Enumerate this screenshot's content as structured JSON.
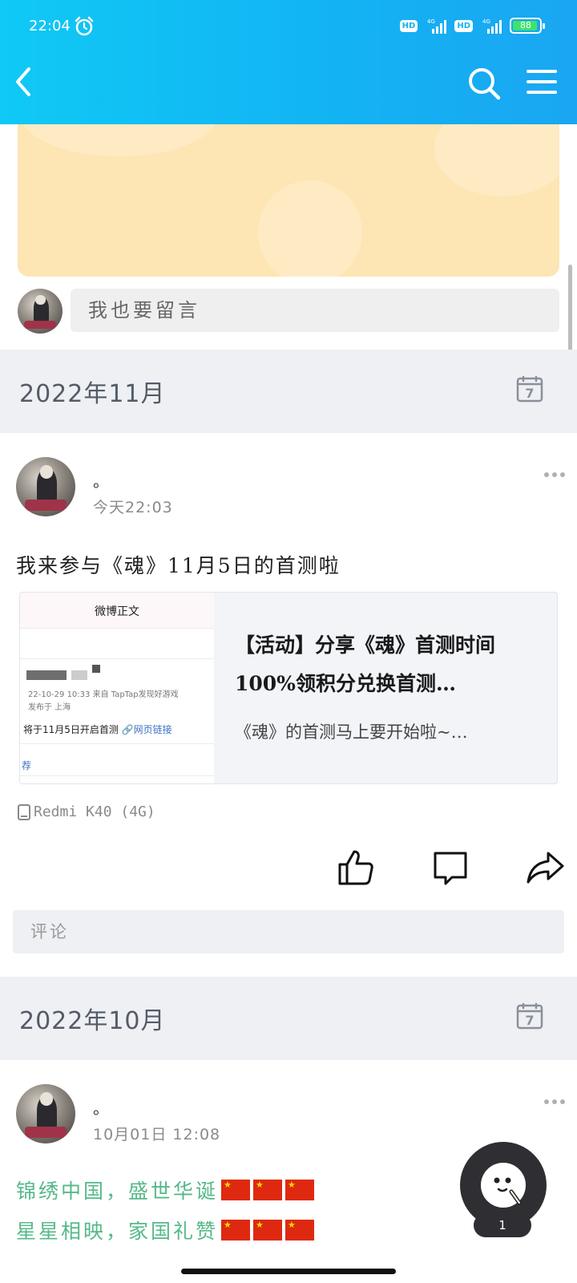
{
  "status_bar": {
    "time": "22:04",
    "hd_label": "HD",
    "net_label": "4G",
    "battery": "88"
  },
  "comment_box": {
    "placeholder": "我也要留言"
  },
  "months": [
    {
      "label": "2022年11月"
    },
    {
      "label": "2022年10月"
    }
  ],
  "posts": [
    {
      "author": "。",
      "time": "今天22:03",
      "text": "我来参与《魂》11月5日的首测啦",
      "link_card": {
        "thumb_title": "微博正文",
        "thumb_meta_1": "22-10-29 10:33  来自 TapTap发现好游戏",
        "thumb_meta_2": "发布于 上海",
        "thumb_start": "将于11月5日开启首测 ",
        "thumb_link": "🔗网页链接",
        "thumb_rec": "荐",
        "title": "【活动】分享《魂》首测时间 100%领积分兑换首测…",
        "desc": "《魂》的首测马上要开始啦~…"
      },
      "device": "Redmi K40 (4G)",
      "comment_placeholder": "评论"
    },
    {
      "author": "。",
      "time": "10月01日 12:08",
      "lines": [
        "锦绣中国，盛世华诞",
        "星星相映，家国礼赞"
      ]
    }
  ],
  "float_button": {
    "count": "1"
  },
  "icons": {
    "accent": "#12b4f3",
    "festive_green": "#55b989",
    "flag_red": "#de2910"
  }
}
